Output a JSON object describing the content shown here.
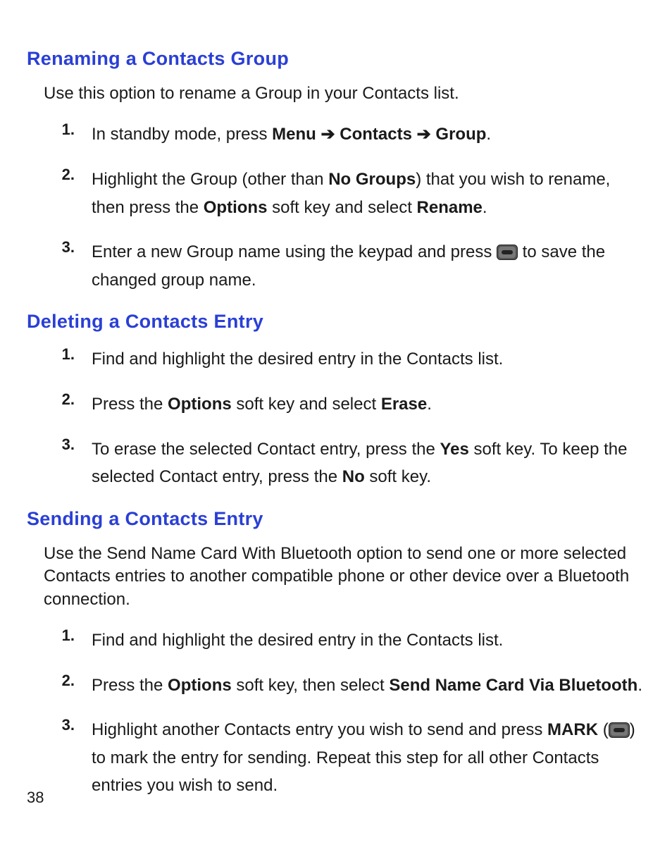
{
  "sections": [
    {
      "heading": "Renaming a Contacts Group",
      "intro": "Use this option to rename a Group in your Contacts list.",
      "steps": [
        {
          "num": "1.",
          "parts": [
            {
              "t": "In standby mode, press "
            },
            {
              "t": "Menu",
              "b": true
            },
            {
              "t": " ",
              "b": true
            },
            {
              "t": "➔",
              "b": true,
              "arrow": true
            },
            {
              "t": " ",
              "b": true
            },
            {
              "t": "Contacts",
              "b": true
            },
            {
              "t": " ",
              "b": true
            },
            {
              "t": "➔",
              "b": true,
              "arrow": true
            },
            {
              "t": " ",
              "b": true
            },
            {
              "t": "Group",
              "b": true
            },
            {
              "t": "."
            }
          ]
        },
        {
          "num": "2.",
          "parts": [
            {
              "t": "Highlight the Group (other than "
            },
            {
              "t": "No Groups",
              "b": true
            },
            {
              "t": ") that you wish to rename, then press the "
            },
            {
              "t": "Options",
              "b": true
            },
            {
              "t": " soft key and select "
            },
            {
              "t": "Rename",
              "b": true
            },
            {
              "t": "."
            }
          ]
        },
        {
          "num": "3.",
          "parts": [
            {
              "t": "Enter a new Group name using the keypad and press "
            },
            {
              "icon": "ok-key-icon"
            },
            {
              "t": " to save the changed group name."
            }
          ]
        }
      ]
    },
    {
      "heading": "Deleting a Contacts Entry",
      "steps": [
        {
          "num": "1.",
          "parts": [
            {
              "t": "Find and highlight the desired entry in the Contacts list."
            }
          ]
        },
        {
          "num": "2.",
          "parts": [
            {
              "t": "Press the "
            },
            {
              "t": "Options",
              "b": true
            },
            {
              "t": " soft key and select "
            },
            {
              "t": "Erase",
              "b": true
            },
            {
              "t": "."
            }
          ]
        },
        {
          "num": "3.",
          "parts": [
            {
              "t": "To erase the selected Contact entry, press the "
            },
            {
              "t": "Yes",
              "b": true
            },
            {
              "t": " soft key. To keep the selected Contact entry, press the "
            },
            {
              "t": "No",
              "b": true
            },
            {
              "t": " soft key."
            }
          ]
        }
      ]
    },
    {
      "heading": "Sending a Contacts Entry",
      "intro": "Use the Send Name Card With Bluetooth option to send one or more selected Contacts entries to another compatible phone or other device over a Bluetooth connection.",
      "steps": [
        {
          "num": "1.",
          "parts": [
            {
              "t": "Find and highlight the desired entry in the Contacts list."
            }
          ]
        },
        {
          "num": "2.",
          "parts": [
            {
              "t": "Press the "
            },
            {
              "t": "Options",
              "b": true
            },
            {
              "t": " soft key, then select "
            },
            {
              "t": "Send Name Card Via Bluetooth",
              "b": true
            },
            {
              "t": "."
            }
          ]
        },
        {
          "num": "3.",
          "parts": [
            {
              "t": "Highlight another Contacts entry you wish to send and press "
            },
            {
              "t": "MARK",
              "b": true
            },
            {
              "t": " ("
            },
            {
              "icon": "ok-key-icon"
            },
            {
              "t": ") to mark the entry for sending. Repeat this step for all other Contacts entries you wish to send."
            }
          ]
        }
      ]
    }
  ],
  "page_number": "38"
}
